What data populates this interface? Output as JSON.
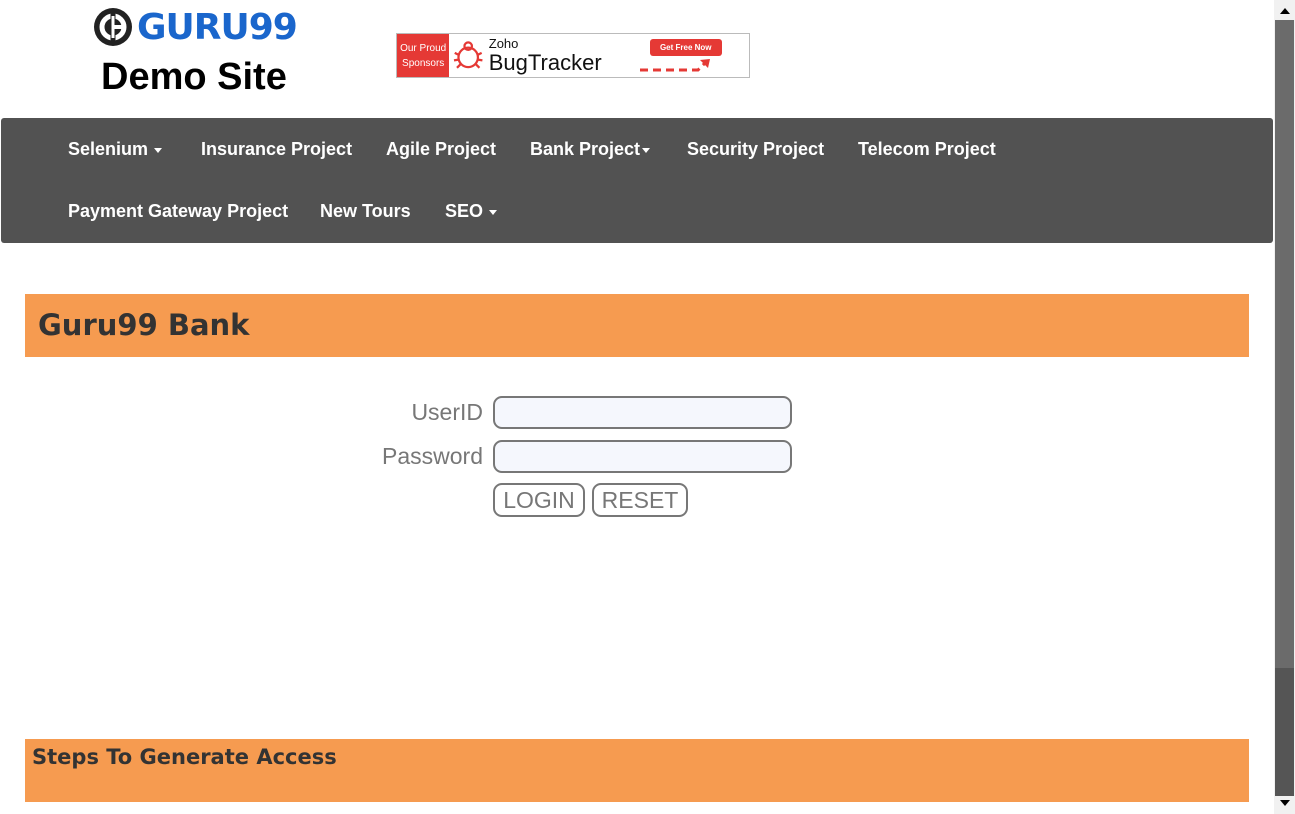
{
  "header": {
    "logo_text": "GURU99",
    "site_title": "Demo Site",
    "sponsor": {
      "left_line1": "Our Proud",
      "left_line2": "Sponsors",
      "brand_small": "Zoho",
      "brand_large": "BugTracker",
      "cta": "Get Free Now"
    }
  },
  "nav": {
    "items": [
      {
        "label": "Selenium",
        "dropdown": true
      },
      {
        "label": "Insurance Project",
        "dropdown": false
      },
      {
        "label": "Agile Project",
        "dropdown": false
      },
      {
        "label": "Bank Project",
        "dropdown": true
      },
      {
        "label": "Security Project",
        "dropdown": false
      },
      {
        "label": "Telecom Project",
        "dropdown": false
      },
      {
        "label": "Payment Gateway Project",
        "dropdown": false
      },
      {
        "label": "New Tours",
        "dropdown": false
      },
      {
        "label": "SEO",
        "dropdown": true
      }
    ]
  },
  "main": {
    "title": "Guru99 Bank",
    "form": {
      "userid_label": "UserID",
      "userid_value": "",
      "password_label": "Password",
      "password_value": "",
      "login_label": "LOGIN",
      "reset_label": "RESET"
    },
    "steps_title": "Steps To Generate Access"
  },
  "colors": {
    "nav_bg": "#525252",
    "accent_orange": "#f69b50",
    "logo_blue": "#1a66cc",
    "sponsor_red": "#e53935"
  },
  "icons": [
    "guru99-logo-icon",
    "bug-icon",
    "caret-down-icon",
    "scroll-up-icon",
    "scroll-down-icon"
  ]
}
